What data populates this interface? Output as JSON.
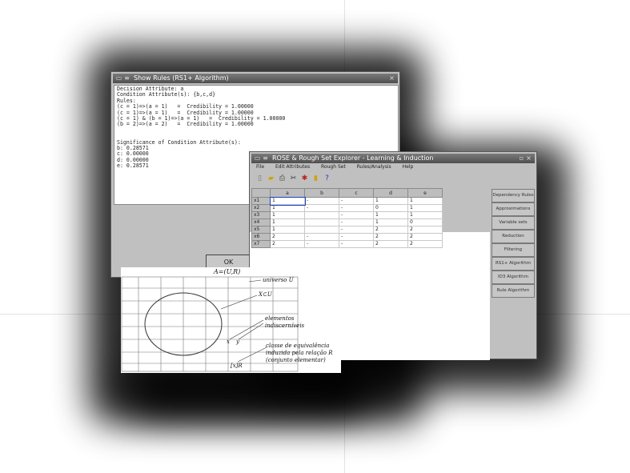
{
  "rules_window": {
    "title": "Show Rules (RS1+ Algorithm)",
    "text": "Decision Attribute: a\nCondition Attribute(s): {b,c,d}\nRules:\n(c = 1)=>(a = 1)   =  Credibility = 1.00000\n(c = 1)=>(a = 1)   =  Credibility = 1.00000\n(c = 1) & (b = 1)=>(a = 1)   =  Credibility = 1.00000\n(b = 2)=>(a = 2)   =  Credibility = 1.00000\n\n\nSignificance of Condition Attribute(s):\nb: 0.28571\nc: 0.00000\nd: 0.00000\ne: 0.28571",
    "ok_label": "OK"
  },
  "main_window": {
    "title": "ROSE & Rough Set Explorer - Learning & Induction",
    "menu": [
      "File",
      "Edit Attributes",
      "Rough Set",
      "Rules/Analysis",
      "Help"
    ],
    "toolbar_icons": [
      "new-file-icon",
      "open-file-icon",
      "print-icon",
      "cut-icon",
      "settings-icon",
      "chart-icon",
      "info-icon"
    ],
    "columns": [
      "",
      "a",
      "b",
      "c",
      "d",
      "e"
    ],
    "rows": [
      {
        "id": "x1",
        "cells": [
          "1",
          "-",
          "-",
          "1",
          "1"
        ]
      },
      {
        "id": "x2",
        "cells": [
          "1",
          "-",
          "-",
          "0",
          "1"
        ]
      },
      {
        "id": "x3",
        "cells": [
          "1",
          "",
          "-",
          "1",
          "1"
        ]
      },
      {
        "id": "x4",
        "cells": [
          "1",
          "",
          "-",
          "1",
          "0"
        ]
      },
      {
        "id": "x5",
        "cells": [
          "1",
          "",
          "-",
          "2",
          "2"
        ]
      },
      {
        "id": "x6",
        "cells": [
          "2",
          "-",
          "-",
          "2",
          "2"
        ]
      },
      {
        "id": "x7",
        "cells": [
          "2",
          "-",
          "-",
          "2",
          "2"
        ]
      }
    ],
    "side_buttons": [
      "Dependency Rules",
      "Approximations",
      "Variable sets",
      "Reduction",
      "Filtering",
      "RS1+ Algorithm",
      "ID3 Algorithm",
      "Rule Algorithm"
    ]
  },
  "diagram": {
    "title": "A=(U,R)",
    "labels": {
      "universe": "universo U",
      "subset": "X⊂U",
      "elements": "elementos",
      "elements2": "indiscerníveis",
      "class1": "classe de equivalência",
      "class2": "induzida pela relação R",
      "class3": "(conjunto elementar)",
      "x": "x",
      "y": "y",
      "eq": "[x]R"
    }
  }
}
